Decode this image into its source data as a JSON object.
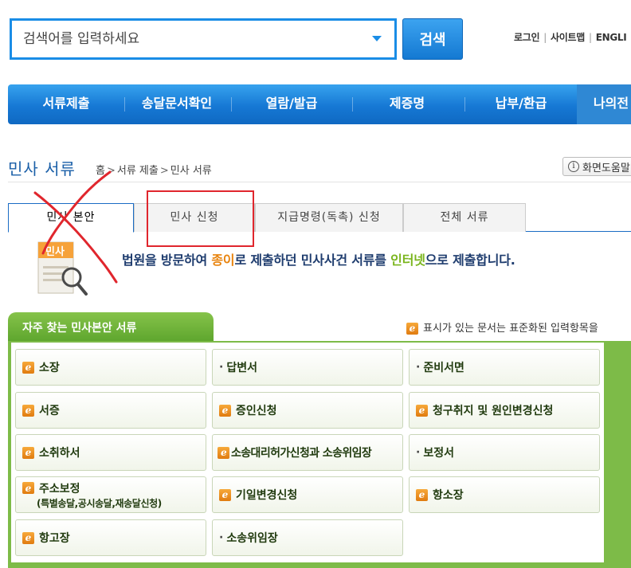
{
  "search": {
    "placeholder": "검색어를 입력하세요",
    "button_label": "검색"
  },
  "util_links": [
    "로그인",
    "사이트맵",
    "ENGLI"
  ],
  "gnb": [
    "서류제출",
    "송달문서확인",
    "열람/발급",
    "제증명",
    "납부/환급",
    "나의전"
  ],
  "page": {
    "title": "민사 서류",
    "breadcrumb": [
      "홈",
      "서류 제출",
      "민사 서류"
    ],
    "help_label": "화면도움말"
  },
  "tabs": [
    "민사 본안",
    "민사 신청",
    "지급명령(독촉) 신청",
    "전체 서류"
  ],
  "intro": {
    "icon_label": "민사",
    "part1": "법원을 방문하여 ",
    "highlight1": "종이",
    "part2": "로 제출하던 민사사건 서류를 ",
    "highlight2": "인터넷",
    "part3": "으로 제출합니다."
  },
  "frequent": {
    "title": "자주 찾는 민사본안 서류",
    "legend": "표시가 있는 문서는 표준화된 입력항목을",
    "docs": [
      {
        "label": "소장",
        "marker": "e"
      },
      {
        "label": "답변서",
        "marker": "dot"
      },
      {
        "label": "준비서면",
        "marker": "dot"
      },
      {
        "label": "서증",
        "marker": "e"
      },
      {
        "label": "증인신청",
        "marker": "e"
      },
      {
        "label": "청구취지 및 원인변경신청",
        "marker": "e"
      },
      {
        "label": "소취하서",
        "marker": "e"
      },
      {
        "label": "소송대리허가신청과 소송위임장",
        "marker": "e"
      },
      {
        "label": "보정서",
        "marker": "dot"
      },
      {
        "label": "주소보정",
        "sub": "(특별송달,공시송달,재송달신청)",
        "marker": "e"
      },
      {
        "label": "기일변경신청",
        "marker": "e"
      },
      {
        "label": "항소장",
        "marker": "e"
      },
      {
        "label": "항고장",
        "marker": "e"
      },
      {
        "label": "소송위임장",
        "marker": "dot"
      }
    ]
  },
  "colors": {
    "primary_blue": "#1a8de6",
    "panel_green": "#7dbb48",
    "annotation_red": "#e0262d"
  }
}
